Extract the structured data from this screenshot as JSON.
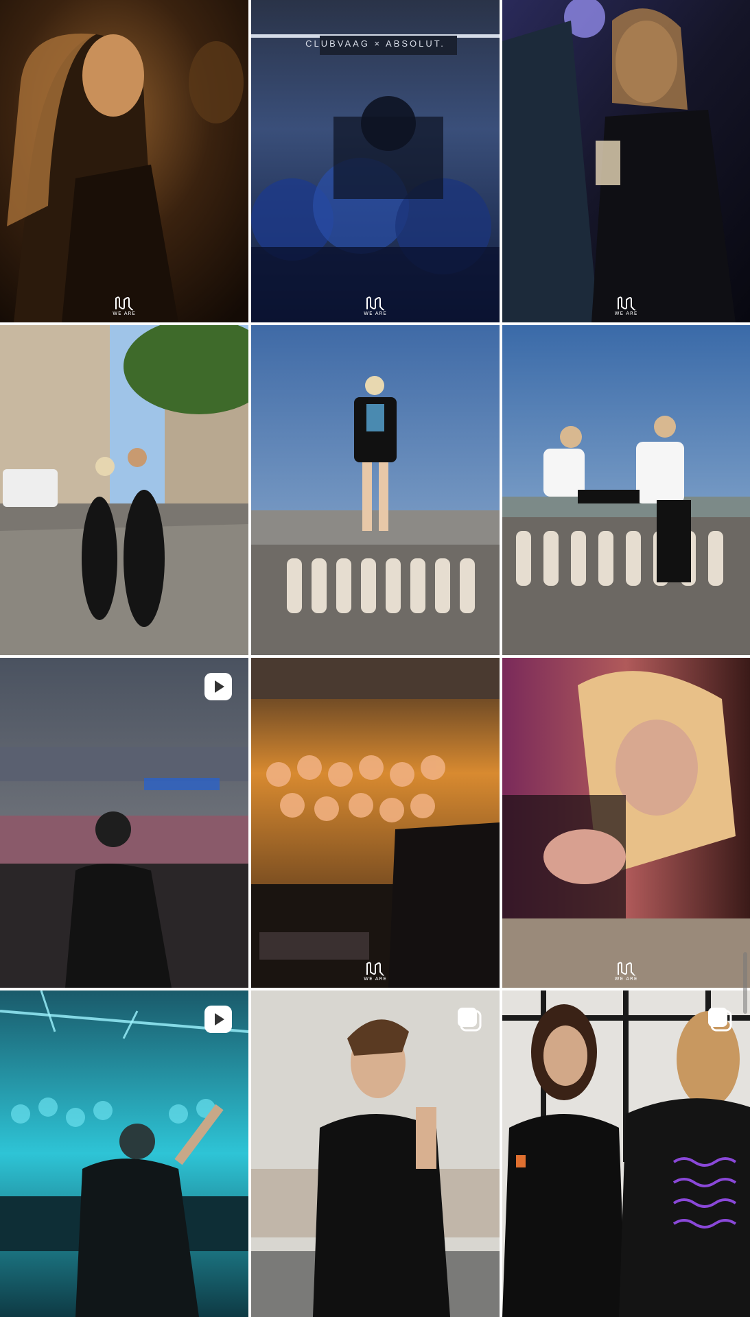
{
  "profile_grid": {
    "logo_caption": "WE ARE",
    "posts": [
      {
        "type": "photo",
        "watermark": true
      },
      {
        "type": "photo",
        "watermark": true,
        "banner_text": "CLUBVAAG × ABSOLUT."
      },
      {
        "type": "photo",
        "watermark": true
      },
      {
        "type": "photo",
        "watermark": false
      },
      {
        "type": "photo",
        "watermark": false
      },
      {
        "type": "photo",
        "watermark": false
      },
      {
        "type": "reel",
        "watermark": false,
        "badge": "play-icon"
      },
      {
        "type": "photo",
        "watermark": true
      },
      {
        "type": "photo",
        "watermark": true
      },
      {
        "type": "reel",
        "watermark": false,
        "badge": "play-icon"
      },
      {
        "type": "carousel",
        "watermark": false,
        "badge": "carousel-icon"
      },
      {
        "type": "carousel",
        "watermark": false,
        "badge": "carousel-icon"
      }
    ]
  },
  "colors": {
    "background": "#ffffff",
    "accent_teal": "#2ec4d6",
    "accent_orange": "#f08a2a"
  }
}
